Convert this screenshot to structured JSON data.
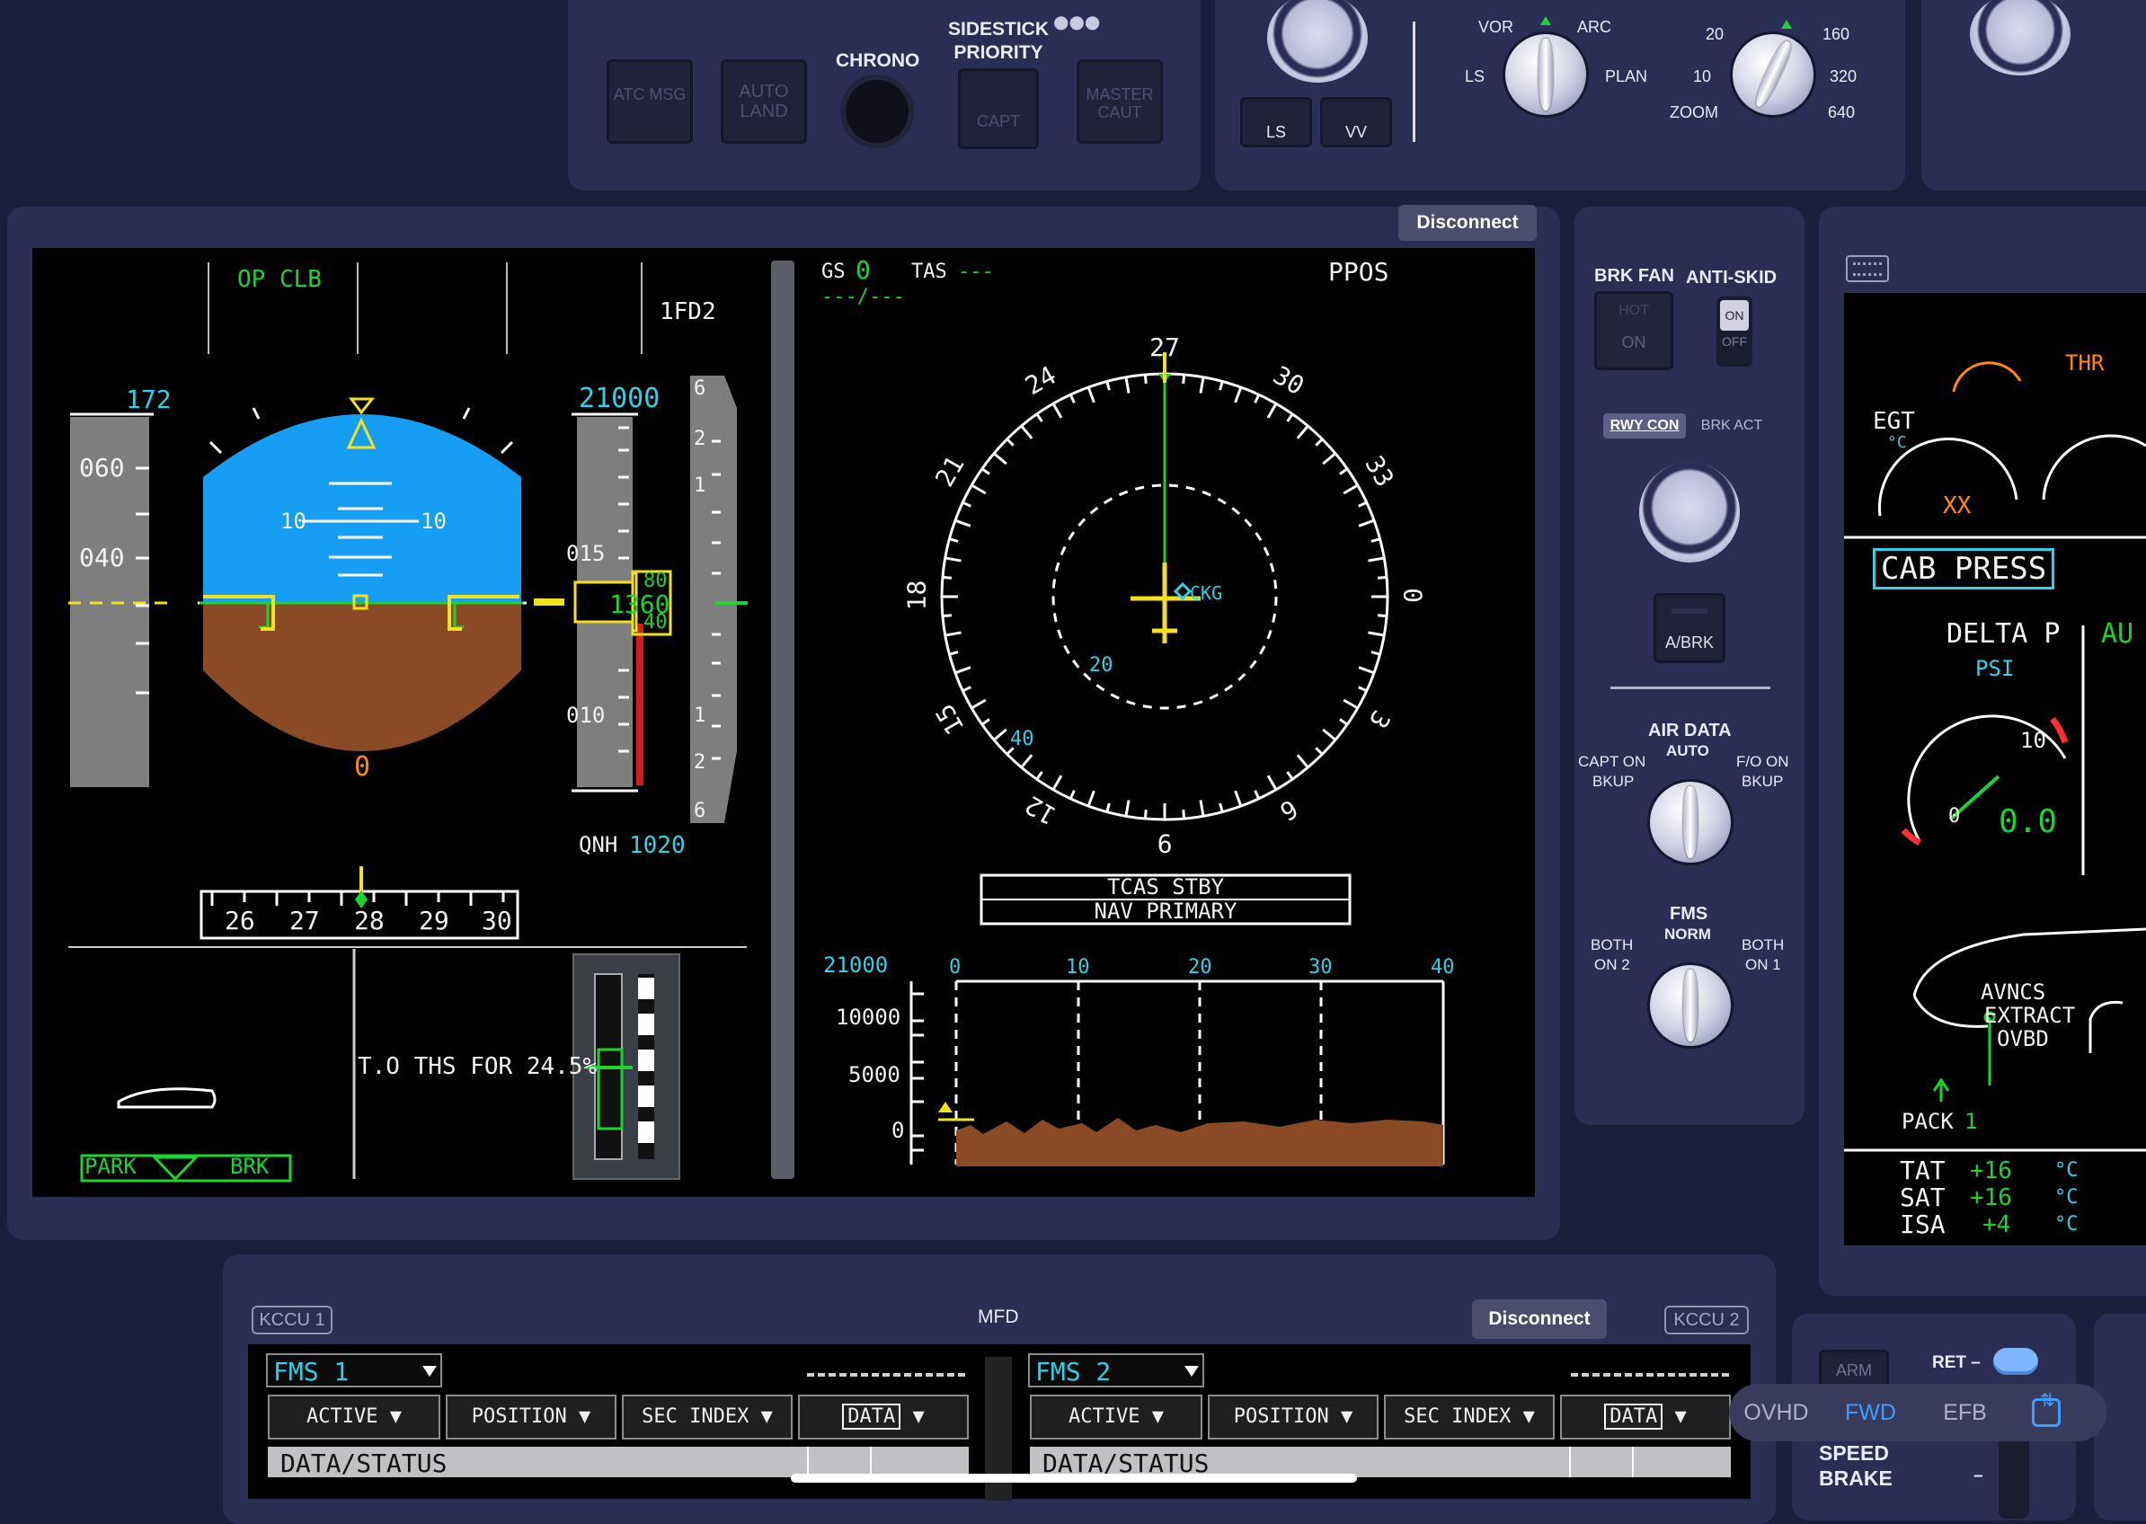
{
  "glareshield": {
    "atc_msg": "ATC MSG",
    "auto_land": "AUTO LAND",
    "chrono": "CHRONO",
    "sidestick_priority": "SIDESTICK PRIORITY",
    "capt": "CAPT",
    "master_caut": "MASTER CAUT"
  },
  "efis": {
    "ls": "LS",
    "vv": "VV",
    "mode_vor": "VOR",
    "mode_arc": "ARC",
    "mode_ls": "LS",
    "mode_plan": "PLAN",
    "range_20": "20",
    "range_160": "160",
    "range_10": "10",
    "range_320": "320",
    "range_zoom": "ZOOM",
    "range_640": "640"
  },
  "pfd": {
    "disconnect": "Disconnect",
    "fma_vertical": "OP CLB",
    "fd": "1FD2",
    "speed_target": "172",
    "speed_060": "060",
    "speed_040": "040",
    "pitch_10_left": "10",
    "pitch_10_right": "10",
    "slip": "0",
    "alt_target": "21000",
    "alt_015": "015",
    "alt_010": "010",
    "alt_80": "80",
    "alt_1360": "1360",
    "alt_40": "40",
    "vs_6_top": "6",
    "vs_2_top": "2",
    "vs_1_top": "1",
    "vs_1_bot": "1",
    "vs_2_bot": "2",
    "vs_6_bot": "6",
    "qnh_label": "QNH",
    "qnh_value": "1020",
    "hdg_26": "26",
    "hdg_27": "27",
    "hdg_28": "28",
    "hdg_29": "29",
    "hdg_30": "30",
    "ths": "T.O THS FOR 24.5%",
    "park": "PARK",
    "brk": "BRK"
  },
  "nd": {
    "gs_label": "GS",
    "gs_value": "0",
    "tas_label": "TAS",
    "tas_value": "---",
    "wind": "---/---",
    "ppos": "PPOS",
    "compass": [
      "27",
      "30",
      "33",
      "0",
      "3",
      "6",
      "9",
      "12",
      "15",
      "18",
      "21",
      "24"
    ],
    "range_20": "20",
    "range_40": "40",
    "waypoint": "CKG",
    "tcas": "TCAS STBY",
    "nav": "NAV PRIMARY",
    "vd_alt": "21000",
    "vd_10000": "10000",
    "vd_5000": "5000",
    "vd_0": "0",
    "vd_x": [
      "0",
      "10",
      "20",
      "30",
      "40"
    ]
  },
  "brakes": {
    "brk_fan": "BRK FAN",
    "anti_skid": "ANTI-SKID",
    "hot": "HOT",
    "on": "ON",
    "as_on": "ON",
    "as_off": "OFF",
    "rwy_con": "RWY CON",
    "brk_act": "BRK ACT",
    "a_brk": "A/BRK",
    "air_data": "AIR DATA",
    "auto": "AUTO",
    "capt_on": "CAPT ON",
    "capt_bkup": "BKUP",
    "fo_on": "F/O ON",
    "fo_bkup": "BKUP",
    "fms": "FMS",
    "norm": "NORM",
    "both_on2_a": "BOTH",
    "both_on2_b": "ON 2",
    "both_on1_a": "BOTH",
    "both_on1_b": "ON 1"
  },
  "sd": {
    "thr": "THR",
    "egt": "EGT",
    "egt_unit": "°C",
    "xx": "XX",
    "cab_press": "CAB PRESS",
    "delta_p": "DELTA P",
    "au": "AU",
    "psi": "PSI",
    "ten": "10",
    "zero": "0",
    "dp_value": "0.0",
    "avncs": "AVNCS",
    "extract": "EXTRACT",
    "ovbd": "OVBD",
    "pack": "PACK",
    "pack_num": "1",
    "tat": "TAT",
    "tat_v": "+16",
    "sat": "SAT",
    "sat_v": "+16",
    "isa": "ISA",
    "isa_v": "+4",
    "deg": "°C"
  },
  "mfd": {
    "kccu1": "KCCU 1",
    "title": "MFD",
    "disconnect": "Disconnect",
    "kccu2": "KCCU 2",
    "fms1": "FMS 1",
    "fms2": "FMS 2",
    "active": "ACTIVE",
    "position": "POSITION",
    "sec_index": "SEC INDEX",
    "data": "DATA",
    "data_status": "DATA/STATUS"
  },
  "speedbrake": {
    "arm": "ARM",
    "ret": "RET",
    "speed": "SPEED",
    "brake": "BRAKE"
  },
  "tabs": {
    "ovhd": "OVHD",
    "fwd": "FWD",
    "efb": "EFB"
  }
}
